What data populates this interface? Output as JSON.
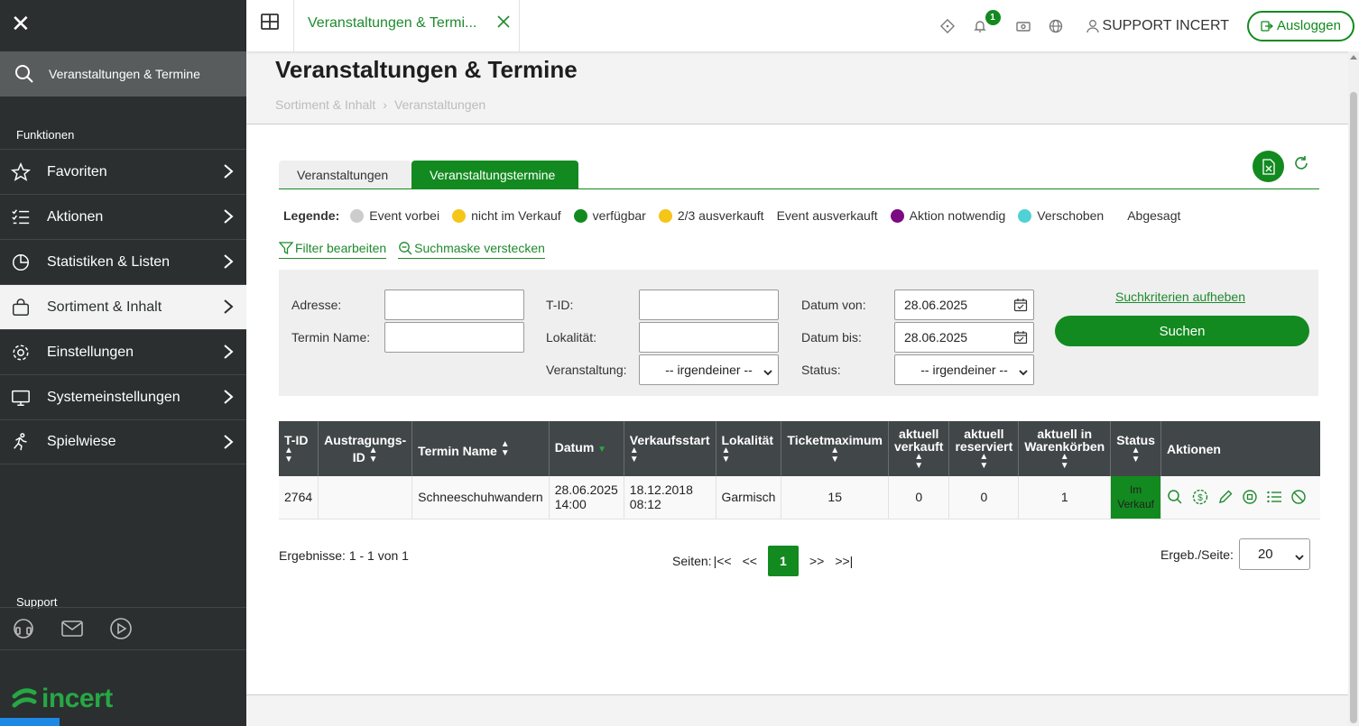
{
  "sidebar": {
    "search_label": "Veranstaltungen & Termine",
    "section_title": "Funktionen",
    "items": [
      {
        "label": "Favoriten"
      },
      {
        "label": "Aktionen"
      },
      {
        "label": "Statistiken & Listen"
      },
      {
        "label": "Sortiment & Inhalt"
      },
      {
        "label": "Einstellungen"
      },
      {
        "label": "Systemeinstellungen"
      },
      {
        "label": "Spielwiese"
      }
    ],
    "support_title": "Support",
    "logo_text": "incert"
  },
  "topbar": {
    "tab_title": "Veranstaltungen & Termi...",
    "notification_count": "1",
    "user_name": "SUPPORT INCERT",
    "logout_label": "Ausloggen"
  },
  "page": {
    "title": "Veranstaltungen & Termine",
    "breadcrumb": [
      "Sortiment & Inhalt",
      "Veranstaltungen"
    ]
  },
  "tabs": {
    "inactive": "Veranstaltungen",
    "active": "Veranstaltungstermine"
  },
  "legend": {
    "title": "Legende:",
    "items": [
      {
        "label": "Event vorbei",
        "color": "#cccccc"
      },
      {
        "label": "nicht im Verkauf",
        "color": "#f5c518"
      },
      {
        "label": "verfügbar",
        "color": "#128a1f"
      },
      {
        "label": "2/3 ausverkauft",
        "color": "#f5c518"
      },
      {
        "label": "Event ausverkauft",
        "color": ""
      },
      {
        "label": "Aktion notwendig",
        "color": "#7b0a83"
      },
      {
        "label": "Verschoben",
        "color": "#4fd1d6"
      },
      {
        "label": "Abgesagt",
        "color": ""
      }
    ]
  },
  "links": {
    "filter": "Filter bearbeiten",
    "hide_search": "Suchmaske verstecken"
  },
  "search": {
    "address_label": "Adresse:",
    "address_value": "",
    "termin_label": "Termin Name:",
    "termin_value": "",
    "tid_label": "T-ID:",
    "tid_value": "",
    "location_label": "Lokalität:",
    "location_value": "",
    "event_label": "Veranstaltung:",
    "event_value": "-- irgendeiner --",
    "date_from_label": "Datum von:",
    "date_from_value": "28.06.2025",
    "date_to_label": "Datum bis:",
    "date_to_value": "28.06.2025",
    "status_label": "Status:",
    "status_value": "-- irgendeiner --",
    "reset_label": "Suchkriterien aufheben",
    "search_button": "Suchen"
  },
  "table": {
    "headers": [
      "T-ID",
      "Austragungs-ID",
      "Termin Name",
      "Datum",
      "Verkaufsstart",
      "Lokalität",
      "Ticketmaximum",
      "aktuell verkauft",
      "aktuell reserviert",
      "aktuell in Warenkörben",
      "Status",
      "Aktionen"
    ],
    "row": {
      "tid": "2764",
      "austragungs_id": "",
      "name": "Schneeschuhwandern",
      "datum": "28.06.2025",
      "uhrzeit": "14:00",
      "verkaufsstart": "18.12.2018",
      "verkaufsstart_zeit": "08:12",
      "lokalitaet": "Garmisch",
      "ticketmaximum": "15",
      "verkauft": "0",
      "reserviert": "0",
      "warenkorb": "1",
      "status_line1": "Im",
      "status_line2": "Verkauf"
    }
  },
  "pagination": {
    "results": "Ergebnisse: 1 - 1 von 1",
    "pages_label": "Seiten:",
    "first": "|<<",
    "prev": "<<",
    "current": "1",
    "next": ">>",
    "last": ">>|",
    "per_page_label": "Ergeb./Seite:",
    "per_page_value": "20"
  }
}
